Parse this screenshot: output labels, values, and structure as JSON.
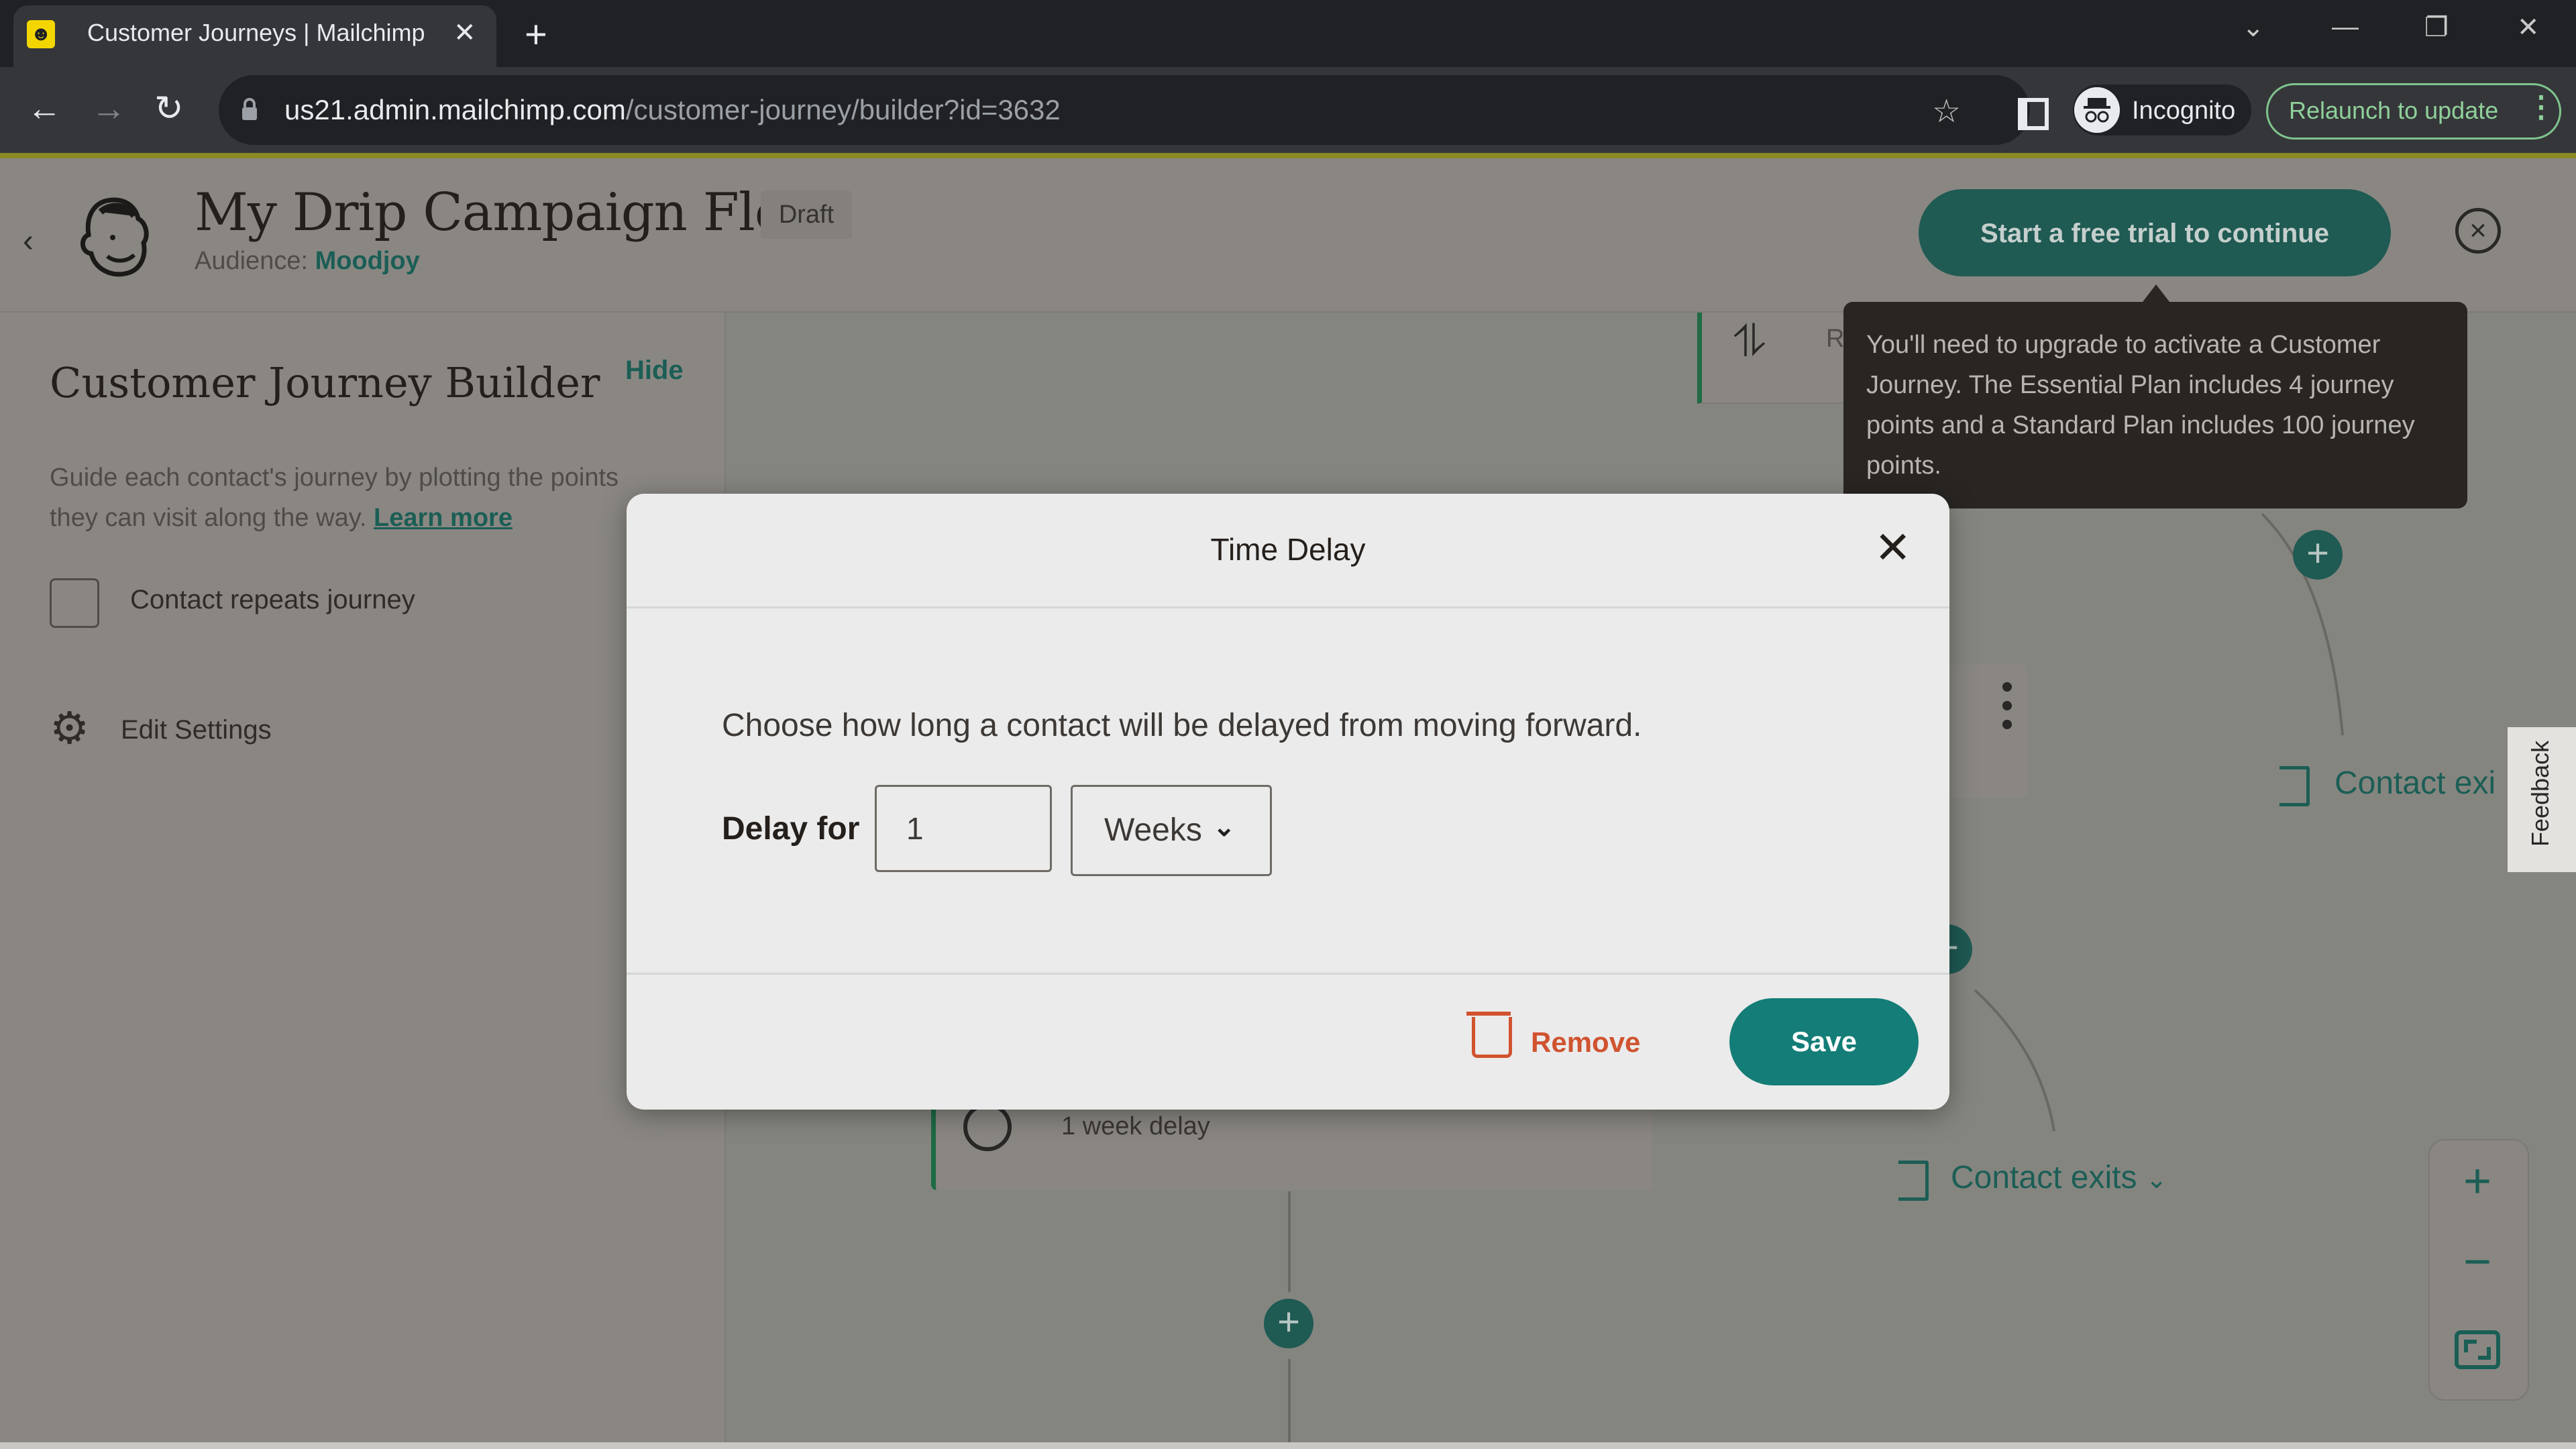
{
  "browser": {
    "tab_title": "Customer Journeys | Mailchimp",
    "tab_favicon": "mailchimp-favicon",
    "url_host": "us21.admin.mailchimp.com",
    "url_path": "/customer-journey/builder?id=3632",
    "profile_label": "Incognito",
    "relaunch_label": "Relaunch to update"
  },
  "header": {
    "title": "My Drip Campaign Flow",
    "status_badge": "Draft",
    "audience_label": "Audience:",
    "audience_value": "Moodjoy",
    "trial_button": "Start a free trial to continue"
  },
  "tooltip": {
    "text": "You'll need to upgrade to activate a Customer Journey. The Essential Plan includes 4 journey points and a Standard Plan includes 100 journey points."
  },
  "sidebar": {
    "title": "Customer Journey Builder",
    "hide_link": "Hide",
    "description": "Guide each contact's journey by plotting the points they can visit along the way.",
    "learn_more": "Learn more",
    "repeat_checkbox_label": "Contact repeats journey",
    "repeat_checked": false,
    "edit_settings": "Edit Settings"
  },
  "canvas": {
    "split_node_label": "R",
    "delay_node_label": "1 week delay",
    "exit_labels": [
      "Contact exits",
      "Contact exi"
    ],
    "feedback_tab": "Feedback"
  },
  "modal": {
    "title": "Time Delay",
    "description": "Choose how long a contact will be delayed from moving forward.",
    "delay_label": "Delay for",
    "delay_value": "1",
    "unit_selected": "Weeks",
    "remove_label": "Remove",
    "save_label": "Save"
  },
  "colors": {
    "brand_teal": "#147d77",
    "dark_teal": "#1f5a53",
    "remove_red": "#d0532f",
    "accent_green": "#1e6b45"
  }
}
